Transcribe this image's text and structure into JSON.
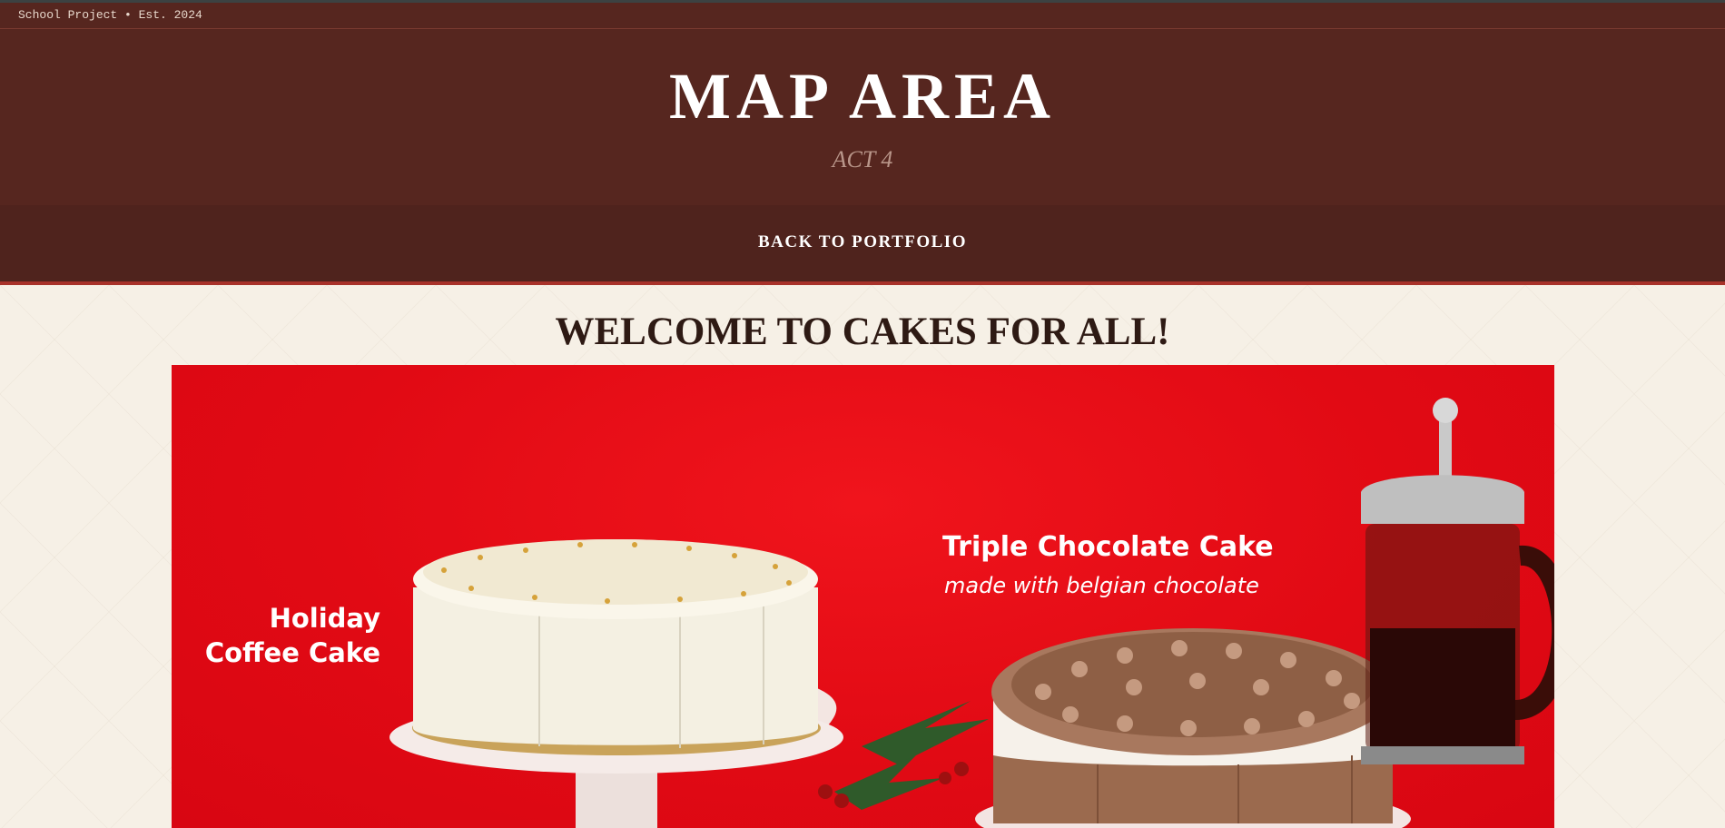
{
  "utility": {
    "text": "School Project • Est. 2024"
  },
  "header": {
    "title": "MAP AREA",
    "subtitle": "ACT 4"
  },
  "nav": {
    "back_label": "BACK TO PORTFOLIO"
  },
  "main": {
    "heading": "WELCOME TO CAKES FOR ALL!"
  },
  "banner": {
    "left_caption_line1": "Holiday",
    "left_caption_line2": "Coffee Cake",
    "right_caption_title": "Triple Chocolate Cake",
    "right_caption_sub": "made with belgian chocolate"
  },
  "colors": {
    "header_bg": "#56261f",
    "nav_bg": "#4f231d",
    "accent": "#a8322a",
    "page_bg": "#f6f0e6",
    "banner_red": "#e10a14"
  }
}
